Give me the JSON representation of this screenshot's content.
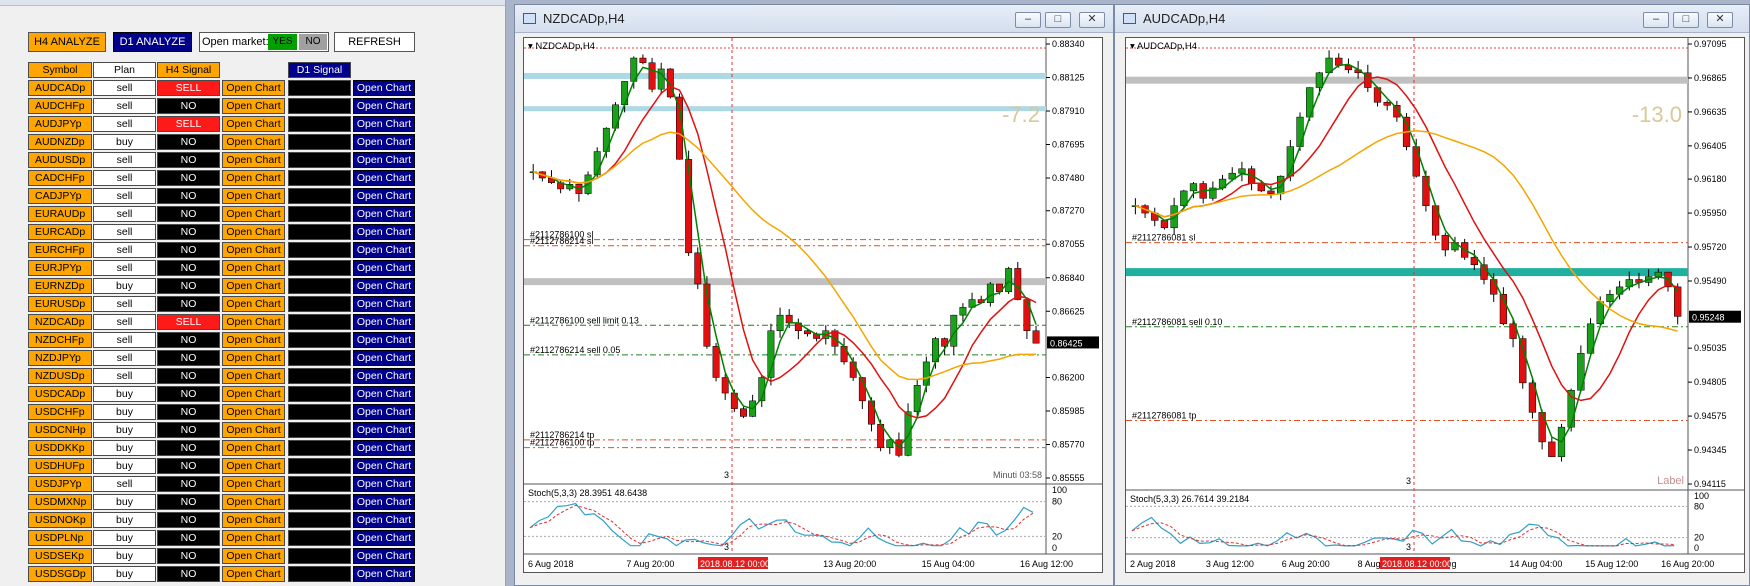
{
  "panel": {
    "h4_analyze": "H4 ANALYZE",
    "d1_analyze": "D1 ANALYZE",
    "open_market_label": "Open market:",
    "open_market_yes": "YES",
    "open_market_no": "NO",
    "refresh": "REFRESH",
    "headers": {
      "symbol": "Symbol",
      "plan": "Plan",
      "h4_signal": "H4 Signal",
      "d1_signal": "D1 Signal"
    },
    "open_chart_label": "Open Chart",
    "rows": [
      {
        "symbol": "AUDCADp",
        "plan": "sell",
        "h4": "SELL"
      },
      {
        "symbol": "AUDCHFp",
        "plan": "sell",
        "h4": "NO"
      },
      {
        "symbol": "AUDJPYp",
        "plan": "sell",
        "h4": "SELL"
      },
      {
        "symbol": "AUDNZDp",
        "plan": "buy",
        "h4": "NO"
      },
      {
        "symbol": "AUDUSDp",
        "plan": "sell",
        "h4": "NO"
      },
      {
        "symbol": "CADCHFp",
        "plan": "sell",
        "h4": "NO"
      },
      {
        "symbol": "CADJPYp",
        "plan": "sell",
        "h4": "NO"
      },
      {
        "symbol": "EURAUDp",
        "plan": "sell",
        "h4": "NO"
      },
      {
        "symbol": "EURCADp",
        "plan": "sell",
        "h4": "NO"
      },
      {
        "symbol": "EURCHFp",
        "plan": "sell",
        "h4": "NO"
      },
      {
        "symbol": "EURJPYp",
        "plan": "sell",
        "h4": "NO"
      },
      {
        "symbol": "EURNZDp",
        "plan": "buy",
        "h4": "NO"
      },
      {
        "symbol": "EURUSDp",
        "plan": "sell",
        "h4": "NO"
      },
      {
        "symbol": "NZDCADp",
        "plan": "sell",
        "h4": "SELL"
      },
      {
        "symbol": "NZDCHFp",
        "plan": "sell",
        "h4": "NO"
      },
      {
        "symbol": "NZDJPYp",
        "plan": "sell",
        "h4": "NO"
      },
      {
        "symbol": "NZDUSDp",
        "plan": "sell",
        "h4": "NO"
      },
      {
        "symbol": "USDCADp",
        "plan": "buy",
        "h4": "NO"
      },
      {
        "symbol": "USDCHFp",
        "plan": "buy",
        "h4": "NO"
      },
      {
        "symbol": "USDCNHp",
        "plan": "buy",
        "h4": "NO"
      },
      {
        "symbol": "USDDKKp",
        "plan": "buy",
        "h4": "NO"
      },
      {
        "symbol": "USDHUFp",
        "plan": "buy",
        "h4": "NO"
      },
      {
        "symbol": "USDJPYp",
        "plan": "sell",
        "h4": "NO"
      },
      {
        "symbol": "USDMXNp",
        "plan": "buy",
        "h4": "NO"
      },
      {
        "symbol": "USDNOKp",
        "plan": "buy",
        "h4": "NO"
      },
      {
        "symbol": "USDPLNp",
        "plan": "buy",
        "h4": "NO"
      },
      {
        "symbol": "USDSEKp",
        "plan": "buy",
        "h4": "NO"
      },
      {
        "symbol": "USDSGDp",
        "plan": "buy",
        "h4": "NO"
      }
    ]
  },
  "colors": {
    "bull": "#1aa01a",
    "bear": "#e01010",
    "ma_fast": "#008000",
    "ma_mid": "#e01010",
    "ma_slow": "#f5a500",
    "band": "#add8e6",
    "zone": "#c0c0c0",
    "teal_zone": "#20b0a0"
  },
  "charts": [
    {
      "id": "nzdcad",
      "window_title": "NZDCADp,H4",
      "chart_label": "NZDCADp,H4",
      "big_value": "-7.2",
      "current_price": "0.86425",
      "price_labels": [
        "0.88340",
        "0.88125",
        "0.87910",
        "0.87695",
        "0.87480",
        "0.87270",
        "0.87055",
        "0.86840",
        "0.86625",
        "0.86425",
        "0.86200",
        "0.85985",
        "0.85770",
        "0.85555"
      ],
      "price_range": [
        0.85555,
        0.8834
      ],
      "orders": [
        {
          "text": "#2112786100 sl",
          "price": 0.87085
        },
        {
          "text": "#2112786214 sl",
          "price": 0.87045
        },
        {
          "text": "#2112786100 sell limit 0.13",
          "price": 0.86535
        },
        {
          "text": "#2112786214 sell 0.05",
          "price": 0.86345
        },
        {
          "text": "#2112786214 tp",
          "price": 0.858
        },
        {
          "text": "#2112786100 tp",
          "price": 0.8575
        }
      ],
      "timer": "Minuti 03:58",
      "stoch_label": "Stoch(5,3,3) 28.3951 48.6438",
      "stoch_levels": [
        "100",
        "80",
        "20",
        "0"
      ],
      "x_labels": [
        "6 Aug 2018",
        "7 Aug 20:00",
        "9 Aug 04:",
        "13 Aug 20:00",
        "15 Aug 04:00",
        "16 Aug 12:00"
      ],
      "time_marker": "2018.08.12 00:00",
      "marker3": "3"
    },
    {
      "id": "audcad",
      "window_title": "AUDCADp,H4",
      "chart_label": "AUDCADp,H4",
      "big_value": "-13.0",
      "current_price": "0.95248",
      "price_labels": [
        "0.97095",
        "0.96865",
        "0.96635",
        "0.96405",
        "0.96180",
        "0.95950",
        "0.95720",
        "0.95490",
        "0.95248",
        "0.95035",
        "0.94805",
        "0.94575",
        "0.94345",
        "0.94115"
      ],
      "price_range": [
        0.94115,
        0.97095
      ],
      "orders": [
        {
          "text": "#2112786081 sl",
          "price": 0.9575
        },
        {
          "text": "#2112786081 sell 0.10",
          "price": 0.9518
        },
        {
          "text": "#2112786081 tp",
          "price": 0.94545
        }
      ],
      "watermark": "Label",
      "stoch_label": "Stoch(5,3,3) 26.7614 39.2184",
      "stoch_levels": [
        "100",
        "80",
        "20",
        "0"
      ],
      "x_labels": [
        "2 Aug 2018",
        "3 Aug 12:00",
        "6 Aug 20:00",
        "8 Aug 04:00",
        "9 Aug",
        "14 Aug 04:00",
        "15 Aug 12:00",
        "16 Aug 20:00"
      ],
      "time_marker": "2018.08.12 00:00",
      "marker3": "3"
    }
  ]
}
